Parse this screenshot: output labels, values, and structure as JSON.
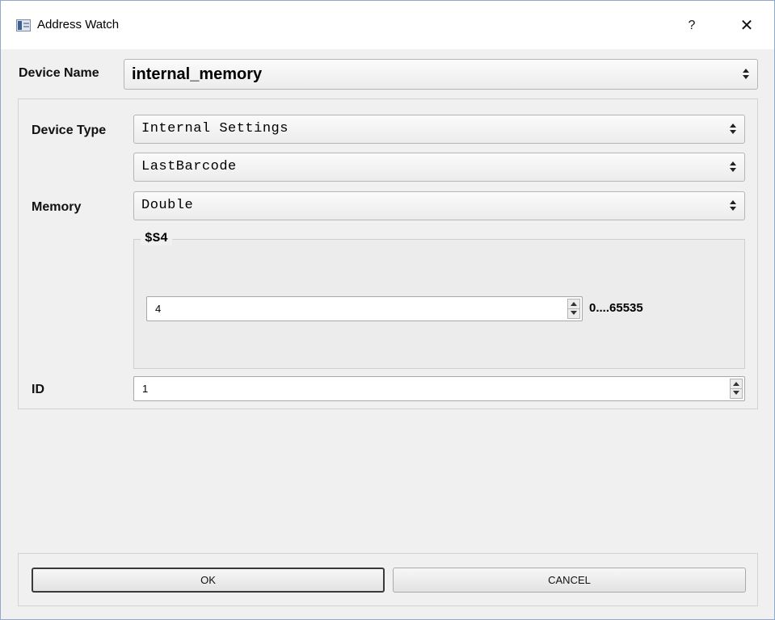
{
  "window": {
    "title": "Address Watch",
    "help_glyph": "?",
    "close_glyph": "✕",
    "icon": "app-window-icon"
  },
  "form": {
    "device_name_label": "Device Name",
    "device_name_value": "internal_memory",
    "device_type_label": "Device Type",
    "device_type_value": "Internal Settings",
    "device_subtype_value": "LastBarcode",
    "memory_label": "Memory",
    "memory_value": "Double",
    "register_group_title": "$S4",
    "register_value": "4",
    "register_range": "0....65535",
    "id_label": "ID",
    "id_value": "1"
  },
  "buttons": {
    "ok_label": "OK",
    "cancel_label": "CANCEL"
  },
  "colors": {
    "background": "#f0f0f0",
    "titlebar": "#ffffff",
    "window_border": "#8fa9c9"
  }
}
